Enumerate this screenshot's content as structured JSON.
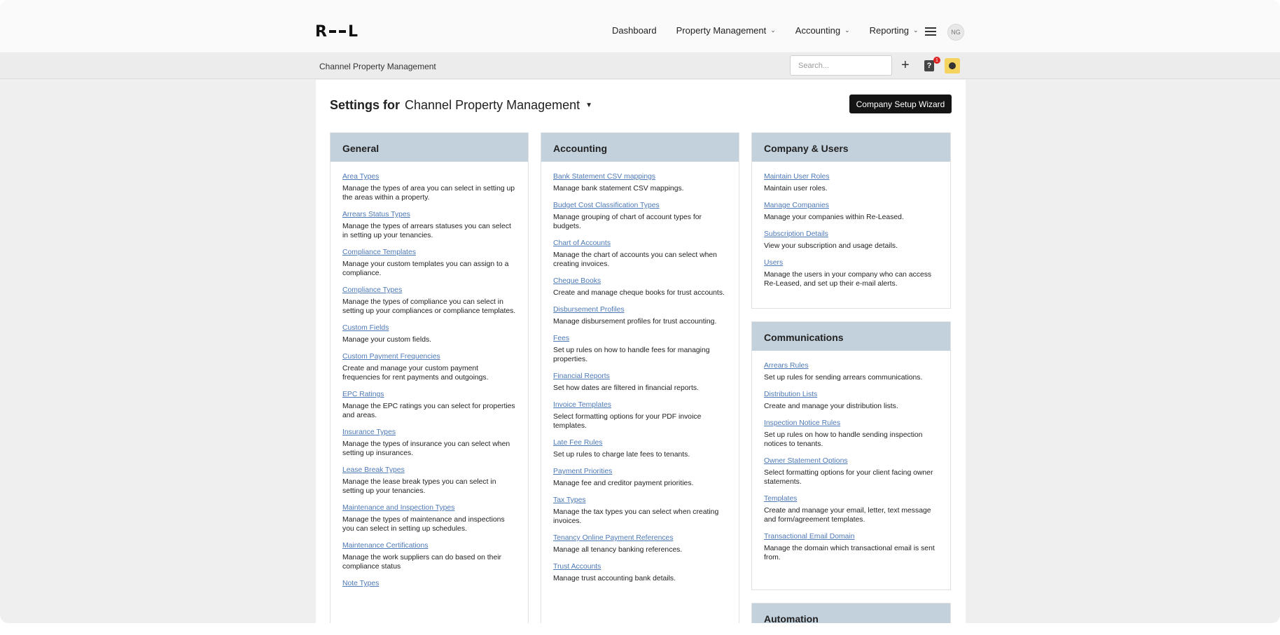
{
  "header": {
    "logo_left": "R",
    "logo_right": "L",
    "nav": [
      {
        "label": "Dashboard",
        "dropdown": false
      },
      {
        "label": "Property Management",
        "dropdown": true
      },
      {
        "label": "Accounting",
        "dropdown": true
      },
      {
        "label": "Reporting",
        "dropdown": true
      }
    ],
    "avatar_initials": "NG"
  },
  "subbar": {
    "breadcrumb": "Channel Property Management",
    "search_placeholder": "Search...",
    "add_label": "+",
    "help_label": "?",
    "notification_count": "1"
  },
  "page": {
    "title_prefix": "Settings for",
    "company_name": "Channel Property Management",
    "wizard_button": "Company Setup Wizard"
  },
  "sections": {
    "general": {
      "title": "General",
      "items": [
        {
          "link": "Area Types",
          "desc": "Manage the types of area you can select in setting up the areas within a property."
        },
        {
          "link": "Arrears Status Types",
          "desc": "Manage the types of arrears statuses you can select in setting up your tenancies."
        },
        {
          "link": "Compliance Templates",
          "desc": "Manage your custom templates you can assign to a compliance."
        },
        {
          "link": "Compliance Types",
          "desc": "Manage the types of compliance you can select in setting up your compliances or compliance templates."
        },
        {
          "link": "Custom Fields",
          "desc": "Manage your custom fields."
        },
        {
          "link": "Custom Payment Frequencies",
          "desc": "Create and manage your custom payment frequencies for rent payments and outgoings."
        },
        {
          "link": "EPC Ratings",
          "desc": "Manage the EPC ratings you can select for properties and areas."
        },
        {
          "link": "Insurance Types",
          "desc": "Manage the types of insurance you can select when setting up insurances."
        },
        {
          "link": "Lease Break Types",
          "desc": "Manage the lease break types you can select in setting up your tenancies."
        },
        {
          "link": "Maintenance and Inspection Types",
          "desc": "Manage the types of maintenance and inspections you can select in setting up schedules."
        },
        {
          "link": "Maintenance Certifications",
          "desc": "Manage the work suppliers can do based on their compliance status"
        },
        {
          "link": "Note Types",
          "desc": ""
        }
      ]
    },
    "accounting": {
      "title": "Accounting",
      "items": [
        {
          "link": "Bank Statement CSV mappings",
          "desc": "Manage bank statement CSV mappings."
        },
        {
          "link": "Budget Cost Classification Types",
          "desc": "Manage grouping of chart of account types for budgets."
        },
        {
          "link": "Chart of Accounts",
          "desc": "Manage the chart of accounts you can select when creating invoices."
        },
        {
          "link": "Cheque Books",
          "desc": "Create and manage cheque books for trust accounts."
        },
        {
          "link": "Disbursement Profiles",
          "desc": "Manage disbursement profiles for trust accounting."
        },
        {
          "link": "Fees",
          "desc": "Set up rules on how to handle fees for managing properties."
        },
        {
          "link": "Financial Reports",
          "desc": "Set how dates are filtered in financial reports."
        },
        {
          "link": "Invoice Templates",
          "desc": "Select formatting options for your PDF invoice templates."
        },
        {
          "link": "Late Fee Rules",
          "desc": "Set up rules to charge late fees to tenants."
        },
        {
          "link": "Payment Priorities",
          "desc": "Manage fee and creditor payment priorities."
        },
        {
          "link": "Tax Types",
          "desc": "Manage the tax types you can select when creating invoices."
        },
        {
          "link": "Tenancy Online Payment References",
          "desc": "Manage all tenancy banking references."
        },
        {
          "link": "Trust Accounts",
          "desc": "Manage trust accounting bank details."
        }
      ]
    },
    "company_users": {
      "title": "Company & Users",
      "items": [
        {
          "link": "Maintain User Roles",
          "desc": "Maintain user roles."
        },
        {
          "link": "Manage Companies",
          "desc": "Manage your companies within Re-Leased."
        },
        {
          "link": "Subscription Details",
          "desc": "View your subscription and usage details."
        },
        {
          "link": "Users",
          "desc": "Manage the users in your company who can access Re-Leased, and set up their e-mail alerts."
        }
      ]
    },
    "communications": {
      "title": "Communications",
      "items": [
        {
          "link": "Arrears Rules",
          "desc": "Set up rules for sending arrears communications."
        },
        {
          "link": "Distribution Lists",
          "desc": "Create and manage your distribution lists."
        },
        {
          "link": "Inspection Notice Rules",
          "desc": "Set up rules on how to handle sending inspection notices to tenants."
        },
        {
          "link": "Owner Statement Options",
          "desc": "Select formatting options for your client facing owner statements."
        },
        {
          "link": "Templates",
          "desc": "Create and manage your email, letter, text message and form/agreement templates."
        },
        {
          "link": "Transactional Email Domain",
          "desc": "Manage the domain which transactional email is sent from."
        }
      ]
    },
    "automation": {
      "title": "Automation",
      "items": []
    }
  }
}
